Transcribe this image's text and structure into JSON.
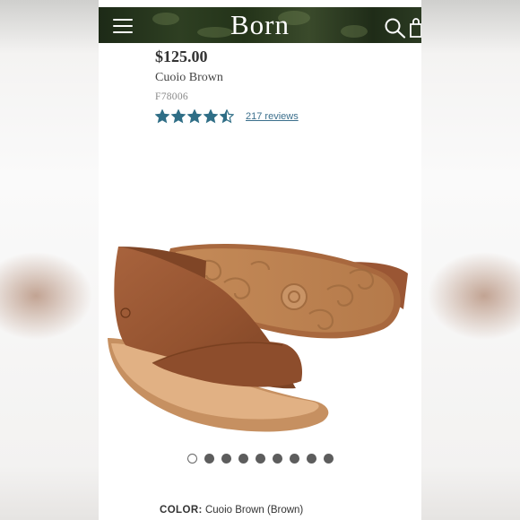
{
  "header": {
    "logo": "Born",
    "menu_icon": "hamburger-menu-icon",
    "search_icon": "search-icon",
    "cart_icon": "shopping-bag-icon"
  },
  "product": {
    "price": "$125.00",
    "color_name": "Cuoio Brown",
    "sku": "F78006",
    "rating": 4.5,
    "rating_max": 5,
    "reviews_link": "217 reviews",
    "image_alt_icon": "sandal-product-image",
    "carousel": {
      "count": 9,
      "active_index": 0
    },
    "color_label": "COLOR:",
    "color_value": "Cuoio Brown (Brown)"
  },
  "colors": {
    "header_bg": "#233319",
    "star": "#2f6e86",
    "link": "#3b6f8c",
    "leather": "#9c5a37",
    "sole": "#c89060"
  }
}
